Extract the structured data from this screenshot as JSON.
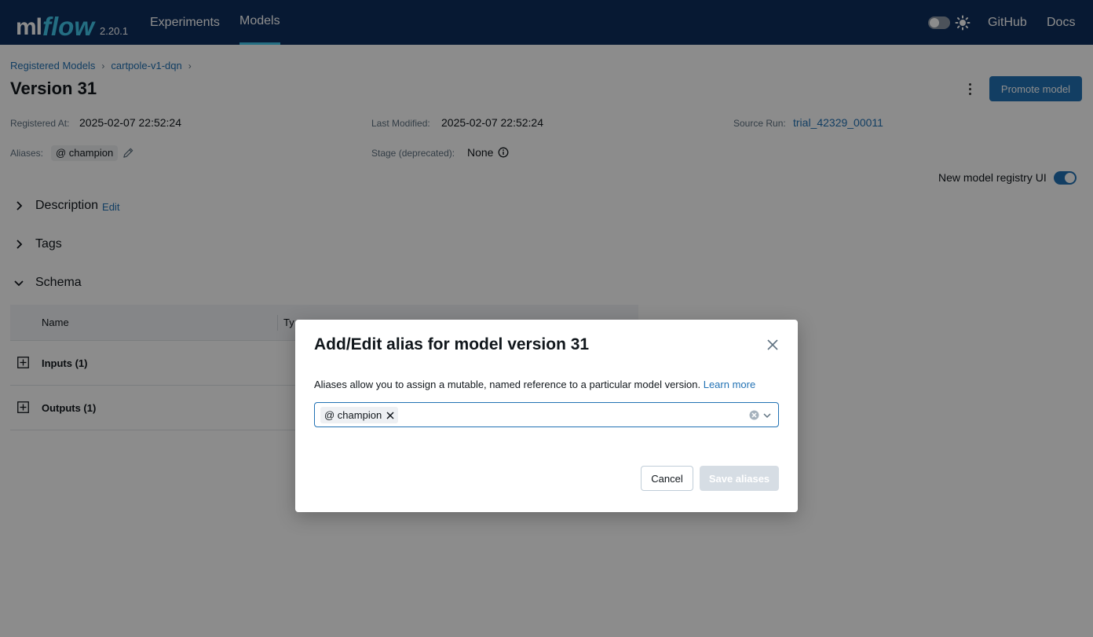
{
  "topbar": {
    "logo_ml": "ml",
    "logo_flow": "flow",
    "version": "2.20.1",
    "nav": [
      "Experiments",
      "Models"
    ],
    "active_nav": "Models",
    "right_links": [
      "GitHub",
      "Docs"
    ]
  },
  "breadcrumb": [
    "Registered Models",
    "cartpole-v1-dqn"
  ],
  "breadcrumb_sep": "›",
  "page": {
    "title": "Version 31",
    "promote_label": "Promote model",
    "registered_at_label": "Registered At:",
    "registered_at": "2025-02-07 22:52:24",
    "last_modified_label": "Last Modified:",
    "last_modified": "2025-02-07 22:52:24",
    "source_run_label": "Source Run:",
    "source_run": "trial_42329_00011",
    "aliases_label": "Aliases:",
    "alias": "@ champion",
    "stage_label": "Stage (deprecated):",
    "stage": "None",
    "registry_ui_label": "New model registry UI",
    "registry_ui_on": true
  },
  "sections": {
    "description": "Description",
    "description_edit": "Edit",
    "tags": "Tags",
    "schema": "Schema"
  },
  "schema_table": {
    "col_name": "Name",
    "col_type": "Ty",
    "rows": [
      "Inputs (1)",
      "Outputs (1)"
    ]
  },
  "modal": {
    "title": "Add/Edit alias for model version 31",
    "description": "Aliases allow you to assign a mutable, named reference to a particular model version.",
    "learn_more": "Learn more",
    "selected_alias": "@ champion",
    "cancel_label": "Cancel",
    "save_label": "Save aliases"
  },
  "colors": {
    "topbar": "#0e2f5e",
    "accent": "#2272b4",
    "logo_flow": "#43c9ed"
  }
}
